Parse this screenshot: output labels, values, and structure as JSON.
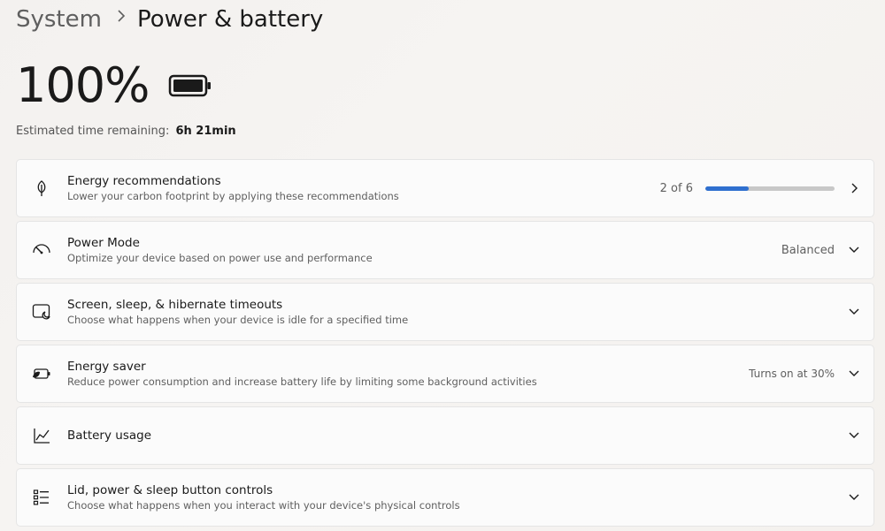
{
  "breadcrumb": {
    "parent": "System",
    "current": "Power & battery"
  },
  "battery": {
    "percent": "100%",
    "estimated_label": "Estimated time remaining:",
    "estimated_value": "6h 21min"
  },
  "cards": {
    "energy_recommendations": {
      "title": "Energy recommendations",
      "description": "Lower your carbon footprint by applying these recommendations",
      "progress_text": "2 of 6",
      "progress_fraction": 0.333
    },
    "power_mode": {
      "title": "Power Mode",
      "description": "Optimize your device based on power use and performance",
      "value": "Balanced"
    },
    "screen_sleep": {
      "title": "Screen, sleep, & hibernate timeouts",
      "description": "Choose what happens when your device is idle for a specified time"
    },
    "energy_saver": {
      "title": "Energy saver",
      "description": "Reduce power consumption and increase battery life by limiting some background activities",
      "value": "Turns on at 30%"
    },
    "battery_usage": {
      "title": "Battery usage"
    },
    "lid_power": {
      "title": "Lid, power & sleep button controls",
      "description": "Choose what happens when you interact with your device's physical controls"
    }
  },
  "colors": {
    "accent": "#2f6fcf"
  },
  "icons": {
    "battery": "battery-full-icon",
    "energy_recommendations": "leaf-icon",
    "power_mode": "gauge-icon",
    "screen_sleep": "screen-moon-icon",
    "energy_saver": "battery-leaf-icon",
    "battery_usage": "line-chart-icon",
    "lid_power": "list-settings-icon",
    "chevron_right": "chevron-right-icon",
    "chevron_down": "chevron-down-icon"
  }
}
